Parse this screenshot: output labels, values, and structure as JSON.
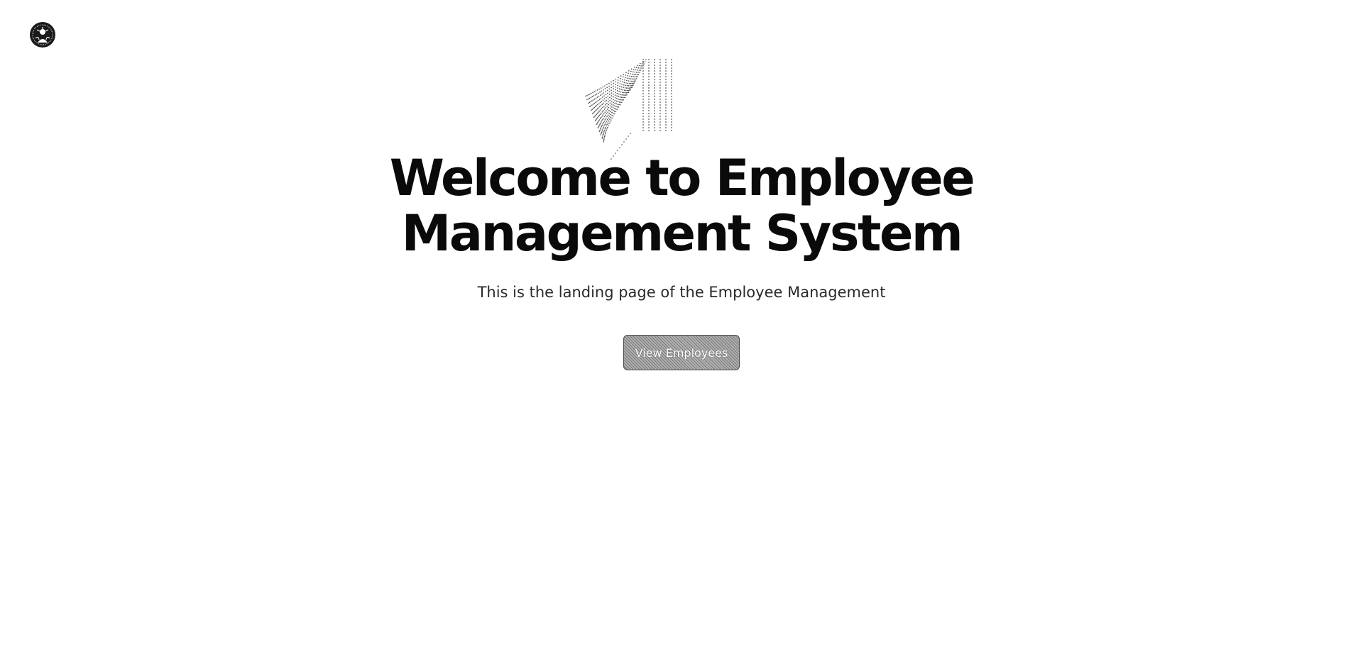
{
  "header": {
    "logo_icon": "siren-logo-icon"
  },
  "hero": {
    "graphic_icon": "dotted-wave-graphic",
    "title": "Welcome to Employee Management System",
    "subtitle": "This is the landing page of the Employee Management",
    "cta_label": "View Employees"
  }
}
